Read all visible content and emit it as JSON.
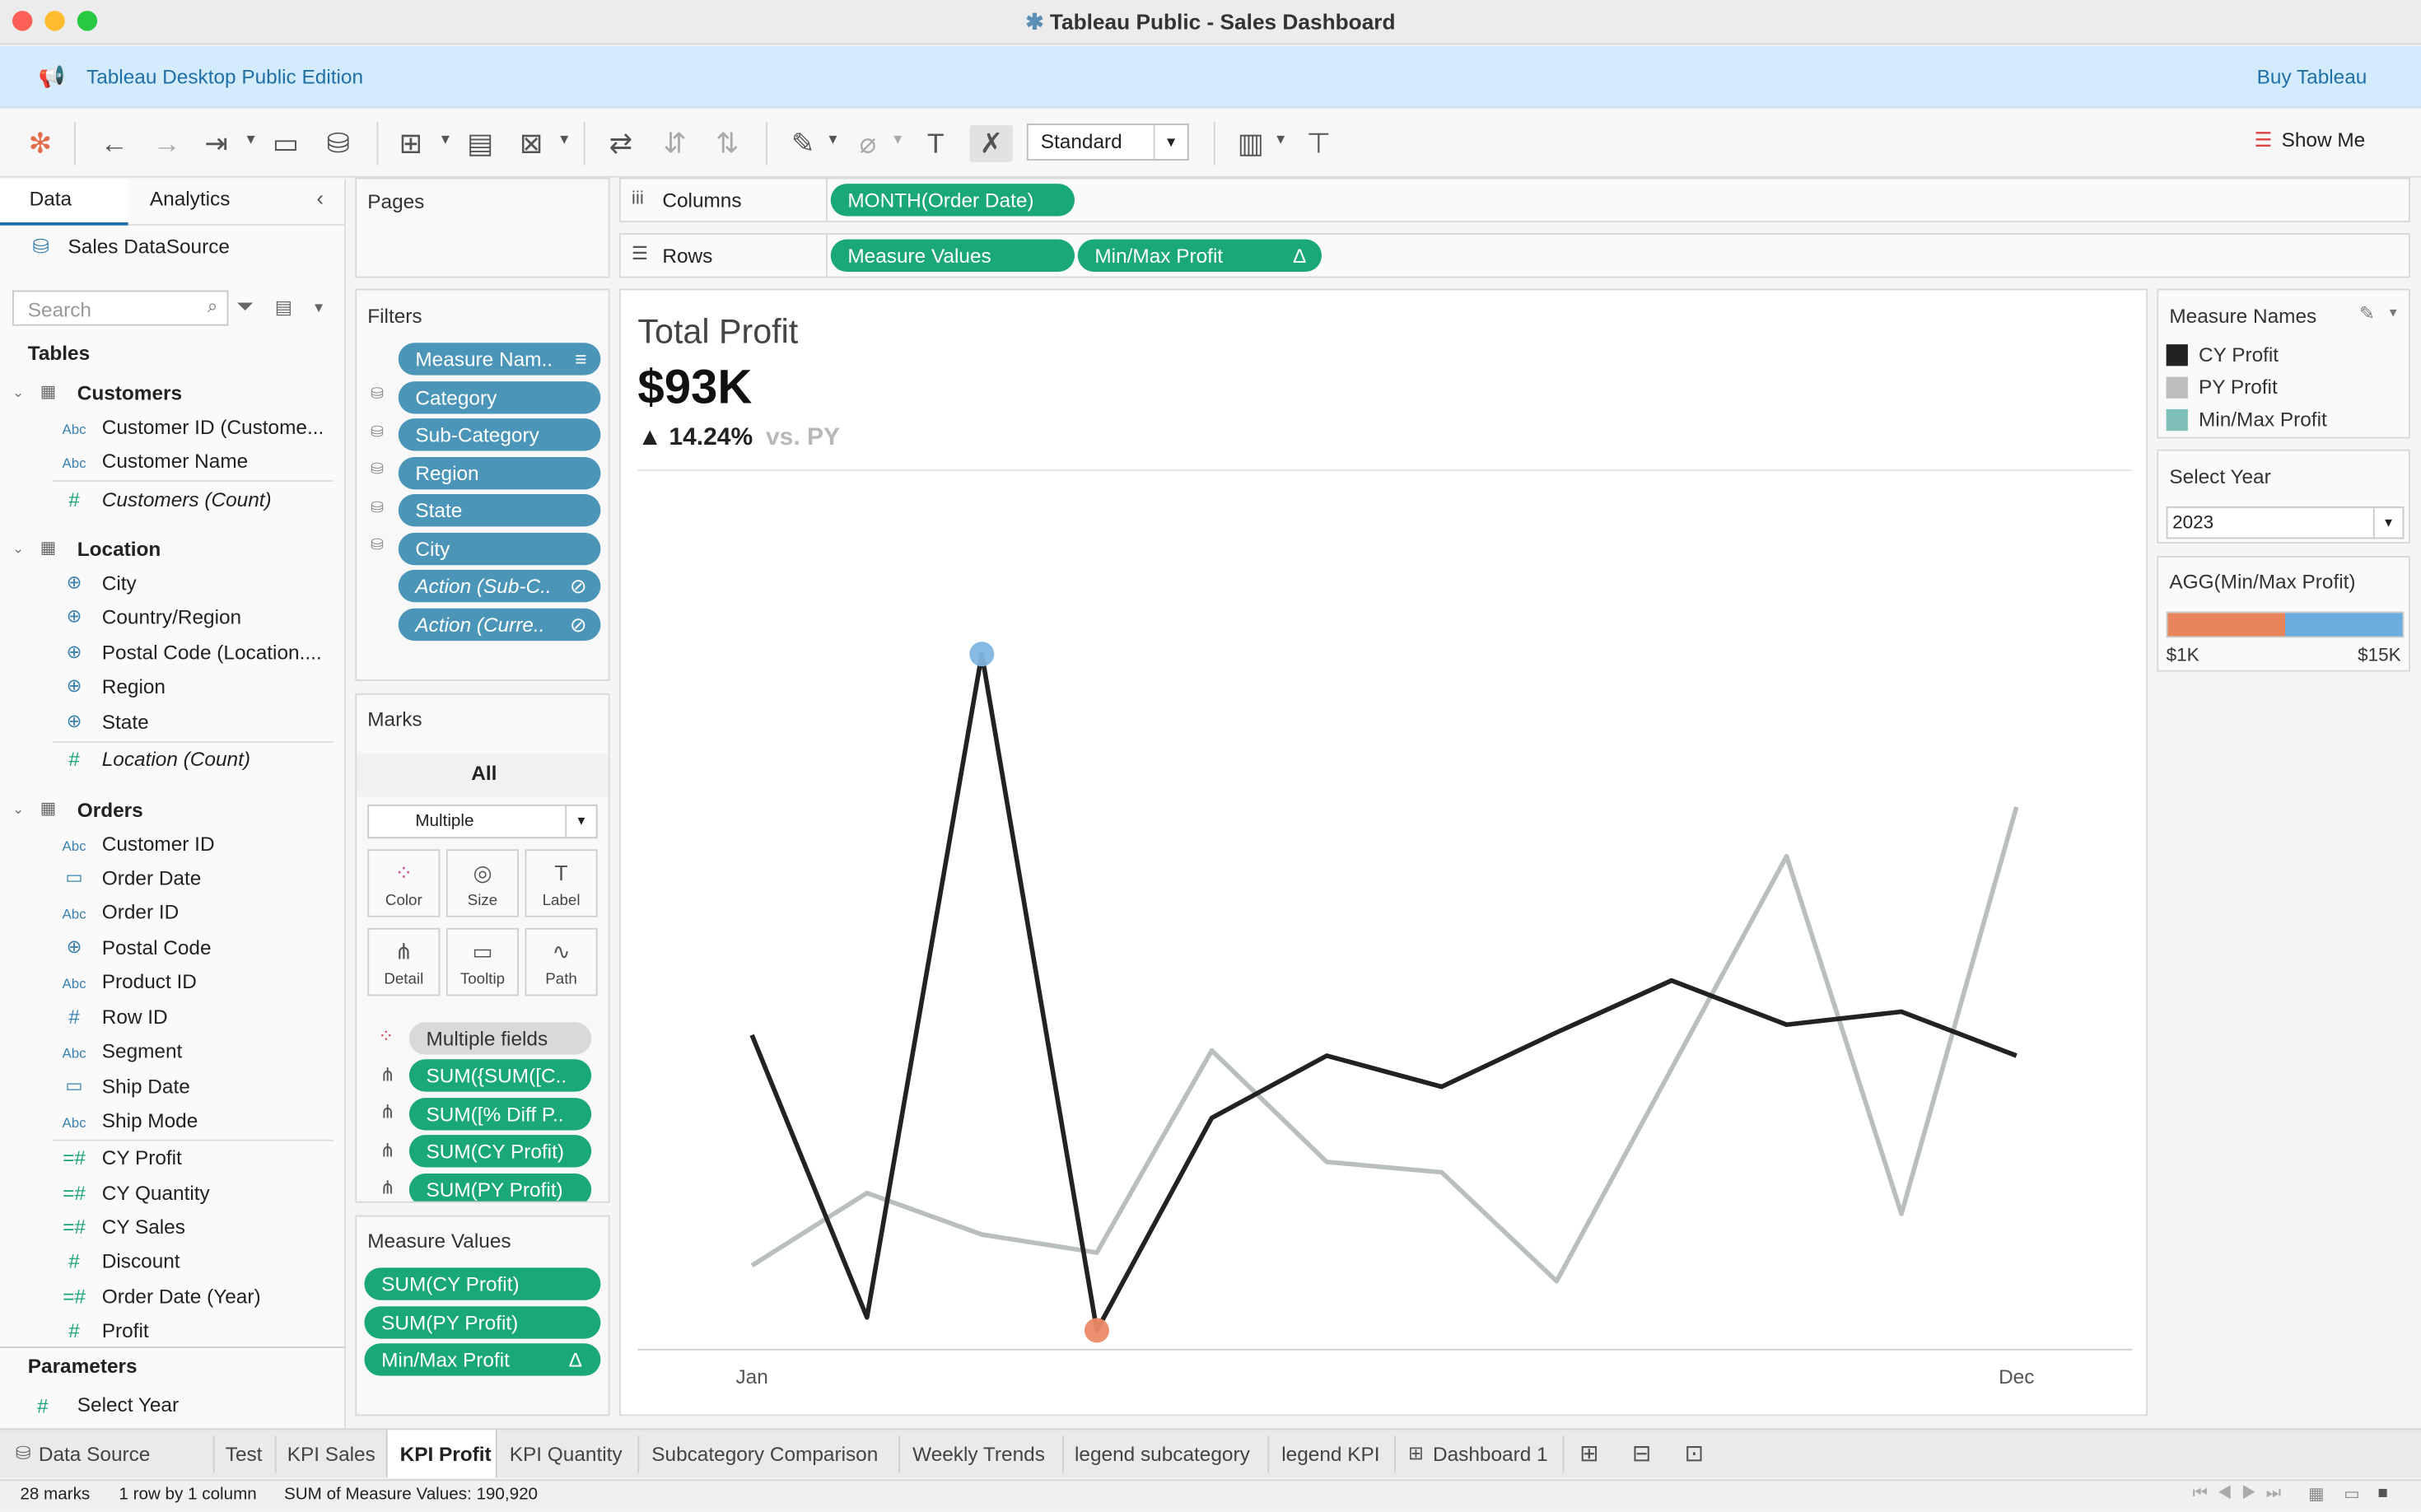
{
  "window": {
    "title": "Tableau Public - Sales Dashboard"
  },
  "banner": {
    "text": "Tableau Desktop Public Edition",
    "buy": "Buy Tableau"
  },
  "toolbar": {
    "view_mode": "Standard",
    "show_me": "Show Me"
  },
  "left": {
    "tabs": [
      "Data",
      "Analytics"
    ],
    "datasource": "Sales DataSource",
    "search_placeholder": "Search",
    "tables_header": "Tables",
    "groups": [
      {
        "name": "Customers",
        "fields": [
          "Customer ID (Custome...",
          "Customer Name",
          "Customers (Count)"
        ]
      },
      {
        "name": "Location",
        "fields": [
          "City",
          "Country/Region",
          "Postal Code (Location....",
          "Region",
          "State",
          "Location (Count)"
        ]
      },
      {
        "name": "Orders",
        "fields": [
          "Customer ID",
          "Order Date",
          "Order ID",
          "Postal Code",
          "Product ID",
          "Row ID",
          "Segment",
          "Ship Date",
          "Ship Mode",
          "CY Profit",
          "CY Quantity",
          "CY Sales",
          "Discount",
          "Order Date (Year)",
          "Profit"
        ]
      }
    ],
    "parameters_header": "Parameters",
    "parameter": "Select Year"
  },
  "pages": {
    "title": "Pages"
  },
  "filters": {
    "title": "Filters",
    "items": [
      "Measure Nam..",
      "Category",
      "Sub-Category",
      "Region",
      "State",
      "City",
      "Action (Sub-C..",
      "Action (Curre.."
    ]
  },
  "marks": {
    "title": "Marks",
    "all": "All",
    "type": "Multiple",
    "buttons": [
      "Color",
      "Size",
      "Label",
      "Detail",
      "Tooltip",
      "Path"
    ],
    "fields": [
      "Multiple fields",
      "SUM({SUM([C..",
      "SUM([% Diff P..",
      "SUM(CY Profit)",
      "SUM(PY Profit)"
    ]
  },
  "measure_values": {
    "title": "Measure Values",
    "items": [
      "SUM(CY Profit)",
      "SUM(PY Profit)",
      "Min/Max Profit"
    ],
    "delta": "Δ"
  },
  "shelves": {
    "columns_label": "Columns",
    "columns_pill": "MONTH(Order Date)",
    "rows_label": "Rows",
    "rows_pills": [
      "Measure Values",
      "Min/Max Profit"
    ],
    "delta": "Δ"
  },
  "kpi": {
    "title": "Total Profit",
    "value": "$93K",
    "change": "▲ 14.24%",
    "vs": "vs. PY"
  },
  "chart_data": {
    "type": "line",
    "x": [
      "Jan",
      "Feb",
      "Mar",
      "Apr",
      "May",
      "Jun",
      "Jul",
      "Aug",
      "Sep",
      "Oct",
      "Nov",
      "Dec"
    ],
    "xtick_labels": [
      "Jan",
      "Dec"
    ],
    "series": [
      {
        "name": "CY Profit",
        "color": "#222222",
        "values": [
          12.2,
          1.3,
          26.9,
          0.8,
          9.0,
          11.4,
          10.2,
          12.3,
          14.3,
          12.6,
          13.1,
          11.4
        ]
      },
      {
        "name": "PY Profit",
        "color": "#b9bebe",
        "values": [
          3.3,
          6.1,
          4.5,
          3.8,
          11.6,
          7.3,
          6.9,
          2.7,
          10.9,
          19.1,
          5.3,
          21.0
        ]
      }
    ],
    "highlights": [
      {
        "label": "max",
        "x": "Mar",
        "value": 26.9,
        "color": "#7fb6e2"
      },
      {
        "label": "min",
        "x": "Apr",
        "value": 0.8,
        "color": "#eb8a66"
      }
    ],
    "ylim": [
      0,
      32
    ],
    "grid": false
  },
  "legend": {
    "title": "Measure Names",
    "items": [
      {
        "name": "CY Profit",
        "color": "#222222"
      },
      {
        "name": "PY Profit",
        "color": "#bdbdbd"
      },
      {
        "name": "Min/Max Profit",
        "color": "#7cc0b8"
      }
    ]
  },
  "select_year": {
    "title": "Select Year",
    "value": "2023"
  },
  "agg": {
    "title": "AGG(Min/Max Profit)",
    "min": "$1K",
    "max": "$15K",
    "min_color": "#e8845a",
    "max_color": "#6aaee0"
  },
  "sheet_tabs": {
    "datasource": "Data Source",
    "tabs": [
      "Test",
      "KPI Sales",
      "KPI Profit",
      "KPI Quantity",
      "Subcategory Comparison",
      "Weekly Trends",
      "legend subcategory",
      "legend KPI",
      "Dashboard 1"
    ],
    "active": "KPI Profit"
  },
  "status": {
    "marks": "28 marks",
    "rows": "1 row by 1 column",
    "sum": "SUM of Measure Values: 190,920"
  }
}
